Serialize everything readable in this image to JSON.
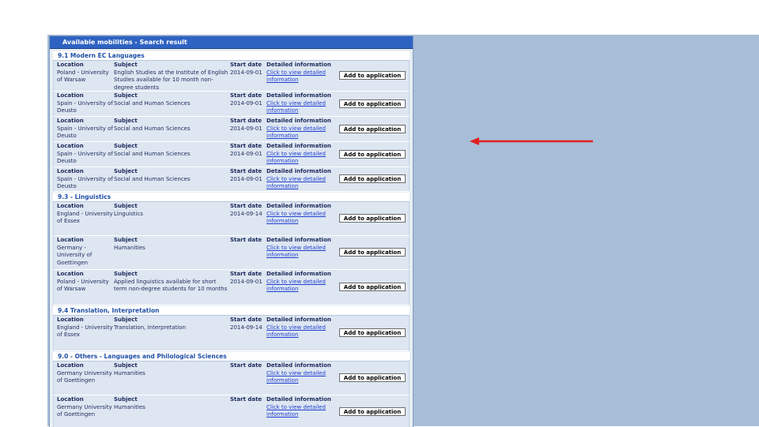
{
  "window": {
    "title": "Available mobilities - Search result"
  },
  "labels": {
    "location": "Location",
    "subject": "Subject",
    "start_date": "Start date",
    "detailed_information": "Detailed information",
    "view_link": "Click to view detailed information",
    "add_button": "Add to application"
  },
  "categories": [
    {
      "heading": "9.1   Modern EC Languages",
      "rows": [
        {
          "location": "Poland - University of Warsaw",
          "subject": "English Studies at the Institute of English Studies available for 10 month non-degree students",
          "date": "2014-09-01"
        },
        {
          "location": "Spain - University of Deusto",
          "subject": "Social and Human Sciences",
          "date": "2014-09-01"
        },
        {
          "location": "Spain - University of Deusto",
          "subject": "Social and Human Sciences",
          "date": "2014-09-01"
        },
        {
          "location": "Spain - University of Deusto",
          "subject": "Social and Human Sciences",
          "date": "2014-09-01"
        },
        {
          "location": "Spain - University of Deusto",
          "subject": "Social and Human Sciences",
          "date": "2014-09-01"
        }
      ]
    },
    {
      "heading": "9.3 - Linguistics",
      "rows": [
        {
          "location": "England - University of Essex",
          "subject": "Linguistics",
          "date": "2014-09-14"
        },
        {
          "location": "Germany - University of Goettingen",
          "subject": "Humanities",
          "date": ""
        },
        {
          "location": "Poland - University of Warsaw",
          "subject": "Applied linguistics available for short term non-degree students for 10 months",
          "date": "2014-09-01"
        }
      ]
    },
    {
      "heading": "9.4   Translation, Interpretation",
      "rows": [
        {
          "location": "England - University of Essex",
          "subject": "Translation, Interpretation",
          "date": "2014-09-14"
        }
      ]
    },
    {
      "heading": "9.0 - Others - Languages and Philological Sciences",
      "rows": [
        {
          "location": "Germany University of Goettingen",
          "subject": "Humanities",
          "date": ""
        },
        {
          "location": "Germany University of Goettingen",
          "subject": "Humanities",
          "date": ""
        }
      ]
    }
  ],
  "colors": {
    "title_bar": "#2f63c2",
    "arrow": "#e02020",
    "background_panel": "#a8bdd7"
  }
}
